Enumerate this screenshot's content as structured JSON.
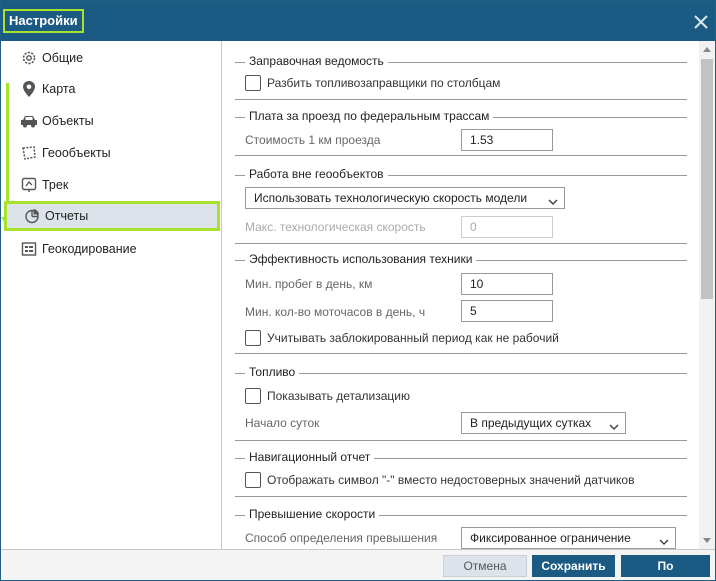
{
  "window": {
    "title": "Настройки"
  },
  "sidebar": {
    "items": [
      {
        "label": "Общие",
        "icon": "gear-icon"
      },
      {
        "label": "Карта",
        "icon": "map-pin-icon"
      },
      {
        "label": "Объекты",
        "icon": "car-icon"
      },
      {
        "label": "Геообъекты",
        "icon": "geofence-icon"
      },
      {
        "label": "Трек",
        "icon": "track-icon"
      },
      {
        "label": "Отчеты",
        "icon": "pie-chart-icon",
        "active": true
      },
      {
        "label": "Геокодирование",
        "icon": "geocoding-icon"
      }
    ]
  },
  "sections": {
    "refuel": {
      "title": "Заправочная ведомость",
      "split_checkbox": "Разбить топливозаправщики по столбцам"
    },
    "toll": {
      "title": "Плата за проезд по федеральным трассам",
      "cost_label": "Стоимость 1 км проезда",
      "cost_value": "1.53"
    },
    "outside": {
      "title": "Работа вне геообъектов",
      "mode_value": "Использовать технологическую скорость модели",
      "max_speed_label": "Макс. технологическая скорость",
      "max_speed_value": "0"
    },
    "efficiency": {
      "title": "Эффективность использования техники",
      "min_mileage_label": "Мин. пробег в день, км",
      "min_mileage_value": "10",
      "min_hours_label": "Мин. кол-во моточасов в день, ч",
      "min_hours_value": "5",
      "blocked_checkbox": "Учитывать заблокированный период как не рабочий"
    },
    "fuel": {
      "title": "Топливо",
      "detail_checkbox": "Показывать детализацию",
      "day_start_label": "Начало суток",
      "day_start_value": "В предыдущих сутках"
    },
    "nav": {
      "title": "Навигационный отчет",
      "symbol_checkbox": "Отображать символ \"-\" вместо недостоверных значений датчиков"
    },
    "speeding": {
      "title": "Превышение скорости",
      "method_label": "Способ определения превышения",
      "method_value": "Фиксированное ограничение"
    }
  },
  "footer": {
    "cancel": "Отмена",
    "save": "Сохранить",
    "default": "По умолчанию"
  },
  "colors": {
    "accent": "#1b5a82",
    "highlight": "#a8e22b"
  }
}
